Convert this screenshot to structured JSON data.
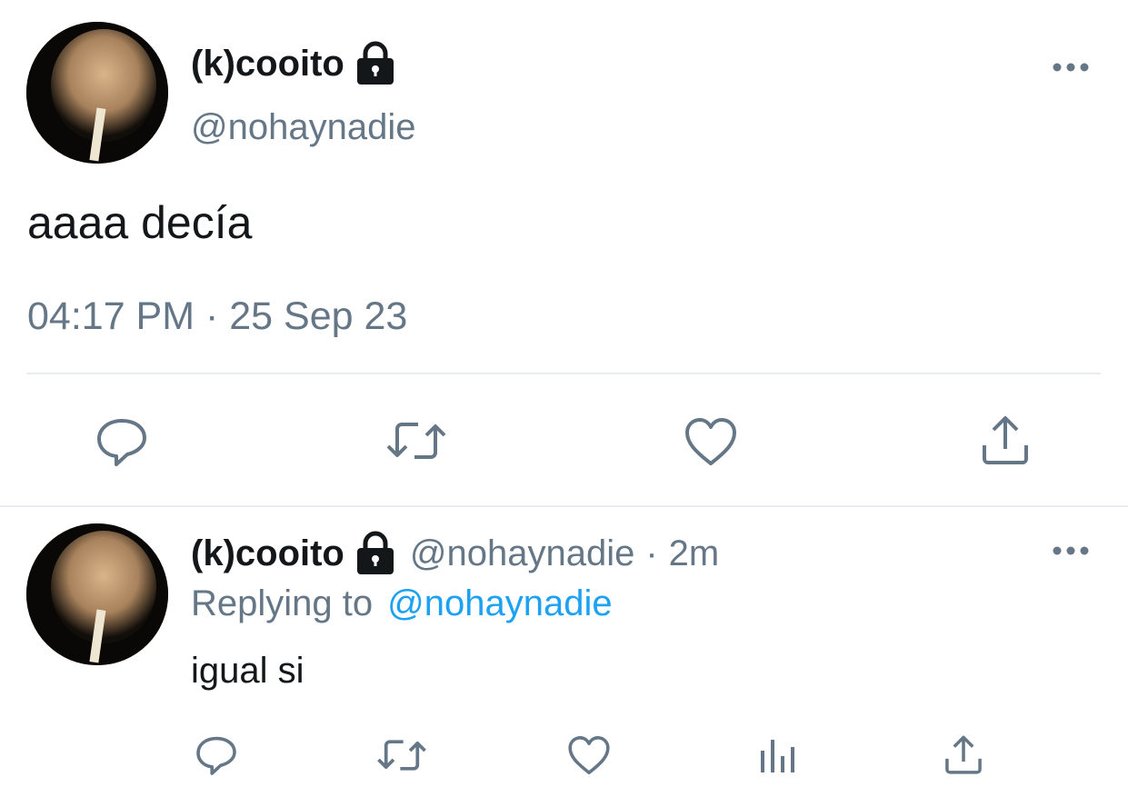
{
  "main_tweet": {
    "display_name": "(k)cooito",
    "handle": "@nohaynadie",
    "text": "aaaa decía",
    "timestamp": "04:17 PM · 25 Sep 23",
    "actions": [
      "reply-icon",
      "retweet-icon",
      "like-icon",
      "share-icon"
    ],
    "protected_icon": "lock-icon",
    "more_icon": "more-icon"
  },
  "reply_tweet": {
    "display_name": "(k)cooito",
    "handle": "@nohaynadie",
    "separator": "·",
    "time": "2m",
    "replying_to_label": "Replying to",
    "replying_to_handle": "@nohaynadie",
    "text": "igual si",
    "actions": [
      "reply-icon",
      "retweet-icon",
      "like-icon",
      "analytics-icon",
      "share-icon"
    ],
    "protected_icon": "lock-icon",
    "more_icon": "more-icon"
  },
  "colors": {
    "text": "#14171a",
    "secondary": "#657786",
    "link": "#1da1f2",
    "divider": "#e6ecf0"
  }
}
